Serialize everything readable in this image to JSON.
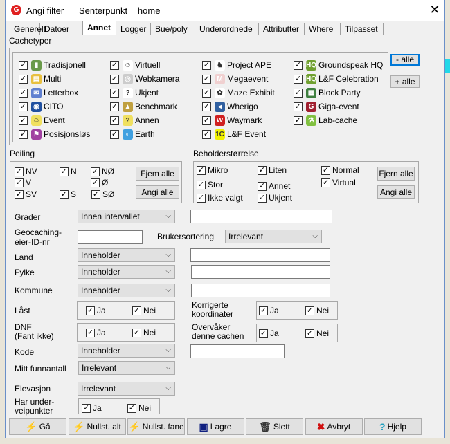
{
  "window": {
    "title": "Angi filter",
    "subtitle": "Senterpunkt = home",
    "close": "✕"
  },
  "tabs": [
    "Generelt",
    "Datoer",
    "Annet",
    "Logger",
    "Bue/poly",
    "Underordnede",
    "Attributter",
    "Where",
    "Tilpasset"
  ],
  "selected_tab": "Annet",
  "cachetyper": {
    "label": "Cachetyper",
    "minus_all": "- alle",
    "plus_all": "+ alle",
    "columns": [
      [
        {
          "label": "Tradisjonell",
          "icon": "traditional-icon",
          "checked": true
        },
        {
          "label": "Multi",
          "icon": "multi-icon",
          "checked": true
        },
        {
          "label": "Letterbox",
          "icon": "letterbox-icon",
          "checked": true
        },
        {
          "label": "CITO",
          "icon": "cito-icon",
          "checked": true
        },
        {
          "label": "Event",
          "icon": "event-icon",
          "checked": true
        },
        {
          "label": "Posisjonsløs",
          "icon": "locationless-icon",
          "checked": true
        }
      ],
      [
        {
          "label": "Virtuell",
          "icon": "virtual-icon",
          "checked": true
        },
        {
          "label": "Webkamera",
          "icon": "webcam-icon",
          "checked": true
        },
        {
          "label": "Ukjent",
          "icon": "unknown-icon",
          "checked": true
        },
        {
          "label": "Benchmark",
          "icon": "benchmark-icon",
          "checked": true
        },
        {
          "label": "Annen",
          "icon": "other-icon",
          "checked": true
        },
        {
          "label": "Earth",
          "icon": "earth-icon",
          "checked": true
        }
      ],
      [
        {
          "label": "Project APE",
          "icon": "project-ape-icon",
          "checked": true
        },
        {
          "label": "Megaevent",
          "icon": "megaevent-icon",
          "checked": true
        },
        {
          "label": "Maze Exhibit",
          "icon": "maze-icon",
          "checked": true
        },
        {
          "label": "Wherigo",
          "icon": "wherigo-icon",
          "checked": true
        },
        {
          "label": "Waymark",
          "icon": "waymark-icon",
          "checked": true
        },
        {
          "label": "L&F Event",
          "icon": "lf-event-icon",
          "checked": true
        }
      ],
      [
        {
          "label": "Groundspeak HQ",
          "icon": "hq-icon",
          "checked": true
        },
        {
          "label": "L&F Celebration",
          "icon": "lf-celebration-icon",
          "checked": true
        },
        {
          "label": "Block Party",
          "icon": "block-party-icon",
          "checked": true
        },
        {
          "label": "Giga-event",
          "icon": "giga-event-icon",
          "checked": true
        },
        {
          "label": "Lab-cache",
          "icon": "lab-cache-icon",
          "checked": true
        }
      ]
    ]
  },
  "peiling": {
    "label": "Peiling",
    "items": [
      "NV",
      "N",
      "NØ",
      "V",
      "Ø",
      "SV",
      "S",
      "SØ"
    ],
    "remove_all": "Fjem alle",
    "set_all": "Angi alle"
  },
  "beholder": {
    "label": "Beholderstørrelse",
    "items": [
      "Mikro",
      "Liten",
      "Normal",
      "Stor",
      "Annet",
      "Virtual",
      "Ikke valgt",
      "Ukjent"
    ],
    "remove_all": "Fjern alle",
    "set_all": "Angi alle"
  },
  "form": {
    "grader": {
      "label": "Grader",
      "select": "Innen intervallet",
      "value": ""
    },
    "eier": {
      "label1": "Geocaching-",
      "label2": "eier-ID-nr",
      "value": ""
    },
    "brukersortering": {
      "label": "Brukersortering",
      "select": "Irrelevant"
    },
    "land": {
      "label": "Land",
      "select": "Inneholder",
      "value": ""
    },
    "fylke": {
      "label": "Fylke",
      "select": "Inneholder",
      "value": ""
    },
    "kommune": {
      "label": "Kommune",
      "select": "Inneholder",
      "value": ""
    },
    "laast": {
      "label": "Låst",
      "yes": "Ja",
      "no": "Nei"
    },
    "korrigerte": {
      "label1": "Korrigerte",
      "label2": "koordinater",
      "yes": "Ja",
      "no": "Nei"
    },
    "dnf": {
      "label1": "DNF",
      "label2": "(Fant ikke)",
      "yes": "Ja",
      "no": "Nei"
    },
    "overvaaker": {
      "label1": "Overvåker",
      "label2": "denne cachen",
      "yes": "Ja",
      "no": "Nei"
    },
    "kode": {
      "label": "Kode",
      "select": "Inneholder",
      "value": ""
    },
    "funnantall": {
      "label": "Mitt funnantall",
      "select": "Irrelevant"
    },
    "elevasjon": {
      "label": "Elevasjon",
      "select": "Irrelevant"
    },
    "under": {
      "label1": "Har under-",
      "label2": "veipunkter",
      "yes": "Ja",
      "no": "Nei"
    }
  },
  "buttons": [
    {
      "label": "Gå",
      "icon": "lightning-icon"
    },
    {
      "label": "Nullst. alt",
      "icon": "lightning-icon"
    },
    {
      "label": "Nullst. fane",
      "icon": "lightning-icon"
    },
    {
      "label": "Lagre",
      "icon": "save-icon"
    },
    {
      "label": "Slett",
      "icon": "trash-icon"
    },
    {
      "label": "Avbryt",
      "icon": "cancel-icon"
    },
    {
      "label": "Hjelp",
      "icon": "help-icon"
    }
  ],
  "colors": {
    "focus": "#0078d7",
    "selected_tab_bg": "#ffffff",
    "dialog_bg": "#f0f0f0"
  }
}
